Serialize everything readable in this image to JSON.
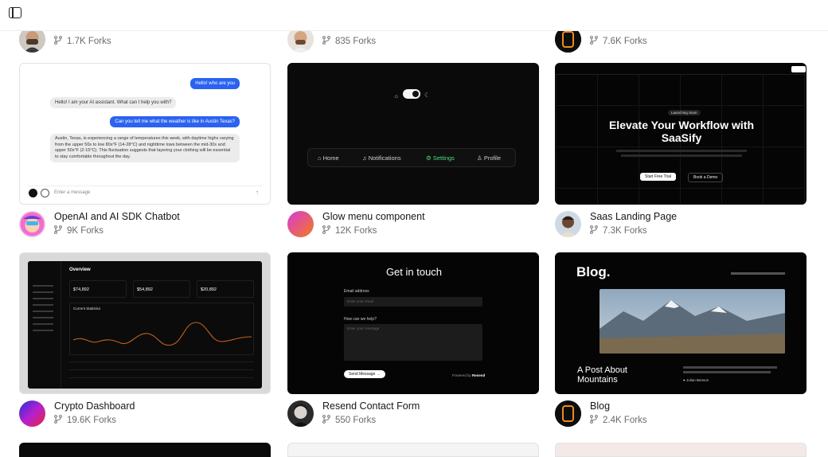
{
  "top_row": [
    {
      "forks": "1.7K Forks"
    },
    {
      "forks": "835 Forks"
    },
    {
      "forks": "7.6K Forks"
    }
  ],
  "cards": [
    {
      "title": "OpenAI and AI SDK Chatbot",
      "forks": "9K Forks"
    },
    {
      "title": "Glow menu component",
      "forks": "12K Forks"
    },
    {
      "title": "Saas Landing Page",
      "forks": "7.3K Forks"
    },
    {
      "title": "Crypto Dashboard",
      "forks": "19.6K Forks"
    },
    {
      "title": "Resend Contact Form",
      "forks": "550 Forks"
    },
    {
      "title": "Blog",
      "forks": "2.4K Forks"
    }
  ],
  "chatbot": {
    "user_1": "Hello! who are you",
    "bot_1": "Hello! I am your AI assistant. What can I help you with?",
    "user_2": "Can you tell me what the weather is like in Austin Texas?",
    "bot_2": "Austin, Texas, is experiencing a range of temperatures this week, with daytime highs varying from the upper 50s to low 80s°F (14-28°C) and nighttime lows between the mid-30s and upper 50s°F (2-15°C). This fluctuation suggests that layering your clothing will be essential to stay comfortable throughout the day.",
    "input_placeholder": "Enter a message"
  },
  "glow_menu": {
    "items": [
      "Home",
      "Notifications",
      "Settings",
      "Profile"
    ]
  },
  "saas": {
    "badge": "Launching Soon",
    "headline_1": "Elevate Your Workflow with",
    "headline_2": "SaaSify",
    "primary_cta": "Start Free Trial",
    "secondary_cta": "Book a Demo"
  },
  "crypto": {
    "heading": "Overview",
    "stats": [
      "$74,892",
      "$54,892",
      "$20,892"
    ],
    "chart_title": "Current Statistics"
  },
  "contact": {
    "heading": "Get in touch",
    "email_label": "Email address",
    "email_placeholder": "Enter your email",
    "message_label": "How can we help?",
    "message_placeholder": "Enter your message",
    "button": "Send Message",
    "powered": "Powered by",
    "powered_brand": "Resend"
  },
  "blog": {
    "logo": "Blog.",
    "post_title_1": "A Post About",
    "post_title_2": "Mountains",
    "author": "Julian Benson"
  },
  "colors": {
    "accent_blue": "#2b63f0",
    "glow_green": "#4ade80"
  }
}
